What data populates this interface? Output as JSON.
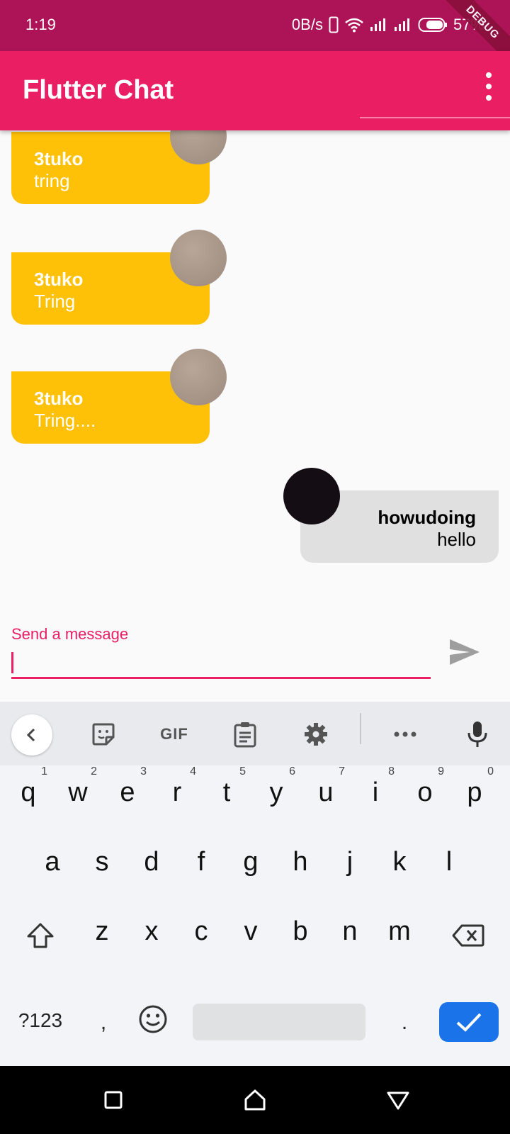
{
  "status_bar": {
    "time": "1:19",
    "network_speed": "0B/s",
    "battery_percent": "57%",
    "debug_label": "DEBUG",
    "icons": [
      "phone-icon",
      "wifi-icon",
      "signal-icon",
      "signal-icon",
      "battery-icon"
    ]
  },
  "app_bar": {
    "title": "Flutter Chat",
    "menu_icon": "more-vert-icon",
    "color": "#e91e63"
  },
  "messages": [
    {
      "user": "3tuko",
      "text": "tring",
      "direction": "incoming",
      "avatar": "avatar-grey",
      "color": "#ffc107"
    },
    {
      "user": "3tuko",
      "text": "Tring",
      "direction": "incoming",
      "avatar": "avatar-grey",
      "color": "#ffc107"
    },
    {
      "user": "3tuko",
      "text": "Tring....",
      "direction": "incoming",
      "avatar": "avatar-grey",
      "color": "#ffc107"
    },
    {
      "user": "howudoing",
      "text": "hello",
      "direction": "outgoing",
      "avatar": "avatar-dark",
      "color": "#e0e0e0"
    }
  ],
  "composer": {
    "label": "Send a message",
    "value": "",
    "send_icon": "send-icon"
  },
  "keyboard": {
    "toolbar": {
      "icons": [
        "back-icon",
        "sticker-icon",
        "gif-icon",
        "clipboard-icon",
        "settings-icon",
        "more-horiz-icon",
        "mic-icon"
      ],
      "gif_label": "GIF"
    },
    "row1": [
      {
        "key": "q",
        "hint": "1"
      },
      {
        "key": "w",
        "hint": "2"
      },
      {
        "key": "e",
        "hint": "3"
      },
      {
        "key": "r",
        "hint": "4"
      },
      {
        "key": "t",
        "hint": "5"
      },
      {
        "key": "y",
        "hint": "6"
      },
      {
        "key": "u",
        "hint": "7"
      },
      {
        "key": "i",
        "hint": "8"
      },
      {
        "key": "o",
        "hint": "9"
      },
      {
        "key": "p",
        "hint": "0"
      }
    ],
    "row2": [
      "a",
      "s",
      "d",
      "f",
      "g",
      "h",
      "j",
      "k",
      "l"
    ],
    "row3": [
      "z",
      "x",
      "c",
      "v",
      "b",
      "n",
      "m"
    ],
    "symbols_label": "?123",
    "comma": ",",
    "period": ".",
    "enter_color": "#1a73e8"
  },
  "nav_bar": {
    "icons": [
      "recents-icon",
      "home-icon",
      "back-nav-icon"
    ]
  }
}
